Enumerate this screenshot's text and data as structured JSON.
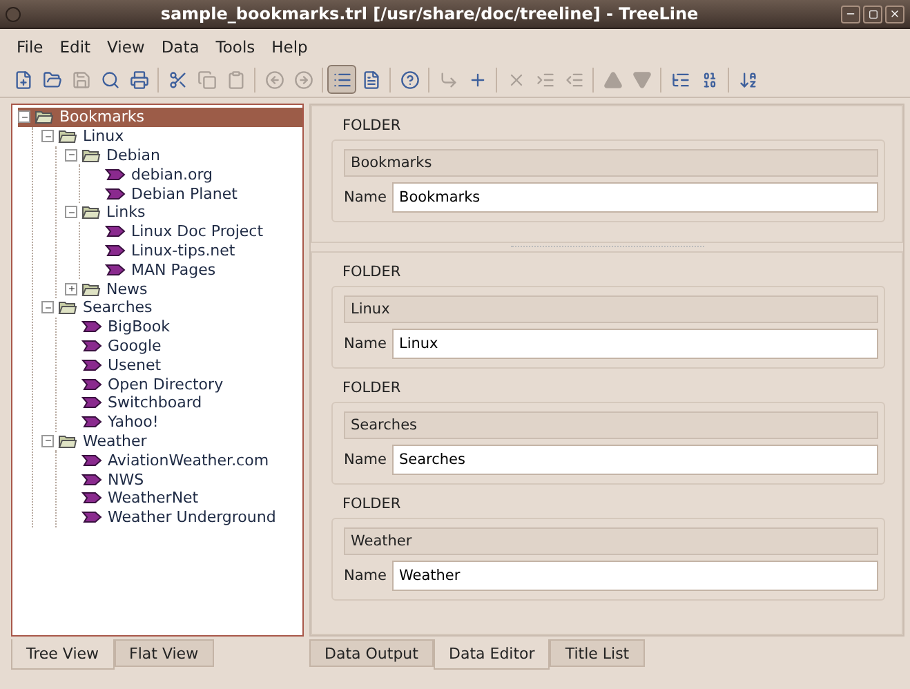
{
  "window": {
    "title": "sample_bookmarks.trl [/usr/share/doc/treeline] - TreeLine"
  },
  "menu": [
    "File",
    "Edit",
    "View",
    "Data",
    "Tools",
    "Help"
  ],
  "toolbar": [
    [
      {
        "kind": "new",
        "disabled": false,
        "pressed": false
      },
      {
        "kind": "open",
        "disabled": false,
        "pressed": false
      },
      {
        "kind": "save",
        "disabled": true,
        "pressed": false
      },
      {
        "kind": "preview",
        "disabled": false,
        "pressed": false
      },
      {
        "kind": "print",
        "disabled": false,
        "pressed": false
      }
    ],
    [
      {
        "kind": "cut",
        "disabled": false,
        "pressed": false
      },
      {
        "kind": "copy",
        "disabled": true,
        "pressed": false
      },
      {
        "kind": "paste",
        "disabled": true,
        "pressed": false
      }
    ],
    [
      {
        "kind": "back",
        "disabled": true,
        "pressed": false
      },
      {
        "kind": "forward",
        "disabled": true,
        "pressed": false
      }
    ],
    [
      {
        "kind": "list",
        "disabled": false,
        "pressed": true
      },
      {
        "kind": "doc",
        "disabled": false,
        "pressed": false
      }
    ],
    [
      {
        "kind": "help",
        "disabled": false,
        "pressed": false
      }
    ],
    [
      {
        "kind": "sibling",
        "disabled": true,
        "pressed": false
      },
      {
        "kind": "child",
        "disabled": false,
        "pressed": false
      }
    ],
    [
      {
        "kind": "delete",
        "disabled": true,
        "pressed": false
      },
      {
        "kind": "indent",
        "disabled": true,
        "pressed": false
      },
      {
        "kind": "unindent",
        "disabled": true,
        "pressed": false
      }
    ],
    [
      {
        "kind": "up",
        "disabled": true,
        "pressed": false
      },
      {
        "kind": "down",
        "disabled": true,
        "pressed": false
      }
    ],
    [
      {
        "kind": "types",
        "disabled": false,
        "pressed": false
      },
      {
        "kind": "numbering",
        "disabled": false,
        "pressed": false
      }
    ],
    [
      {
        "kind": "sort",
        "disabled": false,
        "pressed": false
      }
    ]
  ],
  "tree": [
    {
      "label": "Bookmarks",
      "kind": "folder",
      "expanded": true,
      "selected": true,
      "children": [
        {
          "label": "Linux",
          "kind": "folder",
          "expanded": true,
          "selected": false,
          "children": [
            {
              "label": "Debian",
              "kind": "folder",
              "expanded": true,
              "selected": false,
              "children": [
                {
                  "label": "debian.org",
                  "kind": "bookmark",
                  "selected": false
                },
                {
                  "label": "Debian Planet",
                  "kind": "bookmark",
                  "selected": false
                }
              ]
            },
            {
              "label": "Links",
              "kind": "folder",
              "expanded": true,
              "selected": false,
              "children": [
                {
                  "label": "Linux Doc Project",
                  "kind": "bookmark",
                  "selected": false
                },
                {
                  "label": "Linux-tips.net",
                  "kind": "bookmark",
                  "selected": false
                },
                {
                  "label": "MAN Pages",
                  "kind": "bookmark",
                  "selected": false
                }
              ]
            },
            {
              "label": "News",
              "kind": "folder",
              "expanded": false,
              "selected": false
            }
          ]
        },
        {
          "label": "Searches",
          "kind": "folder",
          "expanded": true,
          "selected": false,
          "children": [
            {
              "label": "BigBook",
              "kind": "bookmark",
              "selected": false
            },
            {
              "label": "Google",
              "kind": "bookmark",
              "selected": false
            },
            {
              "label": "Usenet",
              "kind": "bookmark",
              "selected": false
            },
            {
              "label": "Open Directory",
              "kind": "bookmark",
              "selected": false
            },
            {
              "label": "Switchboard",
              "kind": "bookmark",
              "selected": false
            },
            {
              "label": "Yahoo!",
              "kind": "bookmark",
              "selected": false
            }
          ]
        },
        {
          "label": "Weather",
          "kind": "folder",
          "expanded": true,
          "selected": false,
          "children": [
            {
              "label": "AviationWeather.com",
              "kind": "bookmark",
              "selected": false
            },
            {
              "label": "NWS",
              "kind": "bookmark",
              "selected": false
            },
            {
              "label": "WeatherNet",
              "kind": "bookmark",
              "selected": false
            },
            {
              "label": "Weather Underground",
              "kind": "bookmark",
              "selected": false
            }
          ]
        }
      ]
    }
  ],
  "editor": {
    "panes": [
      {
        "cards": [
          {
            "type": "FOLDER",
            "title": "Bookmarks",
            "field_label": "Name",
            "value": "Bookmarks"
          }
        ]
      },
      {
        "cards": [
          {
            "type": "FOLDER",
            "title": "Linux",
            "field_label": "Name",
            "value": "Linux"
          },
          {
            "type": "FOLDER",
            "title": "Searches",
            "field_label": "Name",
            "value": "Searches"
          },
          {
            "type": "FOLDER",
            "title": "Weather",
            "field_label": "Name",
            "value": "Weather"
          }
        ]
      }
    ]
  },
  "left_tabs": [
    {
      "label": "Tree View",
      "selected": true
    },
    {
      "label": "Flat View",
      "selected": false
    }
  ],
  "right_tabs": [
    {
      "label": "Data Output",
      "selected": false
    },
    {
      "label": "Data Editor",
      "selected": true
    },
    {
      "label": "Title List",
      "selected": false
    }
  ]
}
